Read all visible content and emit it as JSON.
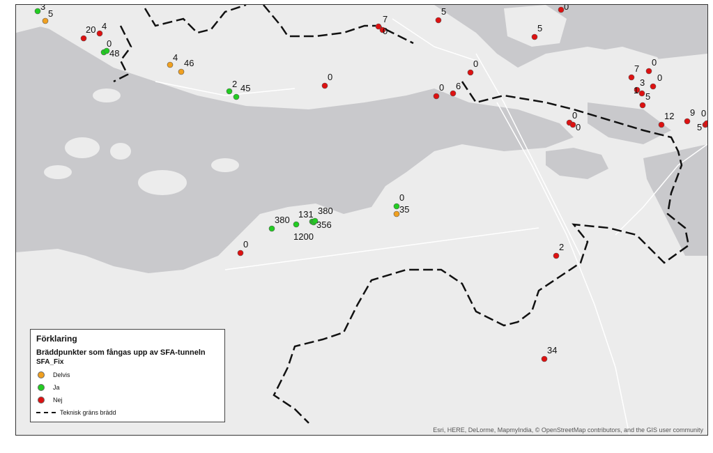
{
  "legend": {
    "title": "Förklaring",
    "subtitle": "Bräddpunkter som fångas upp av SFA-tunneln",
    "field": "SFA_Fix",
    "items": [
      {
        "label": "Delvis",
        "color": "#f0a020"
      },
      {
        "label": "Ja",
        "color": "#22cc22"
      },
      {
        "label": "Nej",
        "color": "#dd1111"
      }
    ],
    "line_label": "Teknisk gräns brädd"
  },
  "attribution": "Esri, HERE, DeLorme, MapmyIndia, © OpenStreetMap contributors, and the GIS user community",
  "points": {
    "delvis": [
      "5",
      "4",
      "46",
      "35"
    ],
    "ja": [
      "3",
      "0",
      "48",
      "2",
      "45",
      "380",
      "1200",
      "131",
      "356",
      "380",
      "0"
    ],
    "nej": [
      "20",
      "4",
      "7",
      "0",
      "5",
      "0",
      "5",
      "0",
      "0",
      "6",
      "0",
      "7",
      "0",
      "3",
      "0",
      "1",
      "5",
      "0",
      "0",
      "12",
      "9",
      "5",
      "0",
      "0",
      "2",
      "34"
    ]
  }
}
